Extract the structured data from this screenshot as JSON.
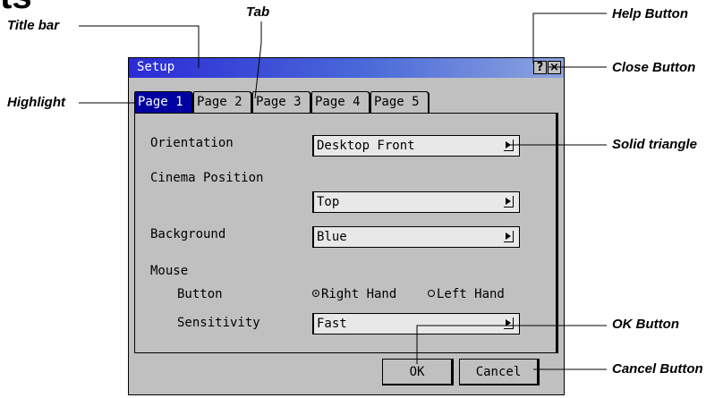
{
  "heading_fragment": "ts",
  "callouts": {
    "title_bar": "Title bar",
    "tab": "Tab",
    "help_button": "Help Button",
    "close_button": "Close Button",
    "highlight": "Highlight",
    "solid_triangle": "Solid triangle",
    "ok_button": "OK Button",
    "cancel_button": "Cancel Button"
  },
  "dialog": {
    "title": "Setup",
    "help_label": "?",
    "close_label": "×",
    "tabs": [
      {
        "label": "Page 1",
        "active": true
      },
      {
        "label": "Page 2",
        "active": false
      },
      {
        "label": "Page 3",
        "active": false
      },
      {
        "label": "Page 4",
        "active": false
      },
      {
        "label": "Page 5",
        "active": false
      }
    ],
    "orientation": {
      "label": "Orientation",
      "value": "Desktop Front"
    },
    "cinema_position": {
      "label": "Cinema Position",
      "value": "Top"
    },
    "background": {
      "label": "Background",
      "value": "Blue"
    },
    "mouse": {
      "label": "Mouse",
      "button_label": "Button",
      "right_hand": "Right Hand",
      "left_hand": "Left Hand",
      "selected": "Right Hand",
      "sensitivity_label": "Sensitivity",
      "sensitivity_value": "Fast"
    },
    "ok_label": "OK",
    "cancel_label": "Cancel"
  },
  "colors": {
    "titlebar_start": "#2b2bd6",
    "titlebar_end": "#8ea4e0",
    "highlight": "#0000a0",
    "dialog_bg": "#c0c0c0"
  }
}
